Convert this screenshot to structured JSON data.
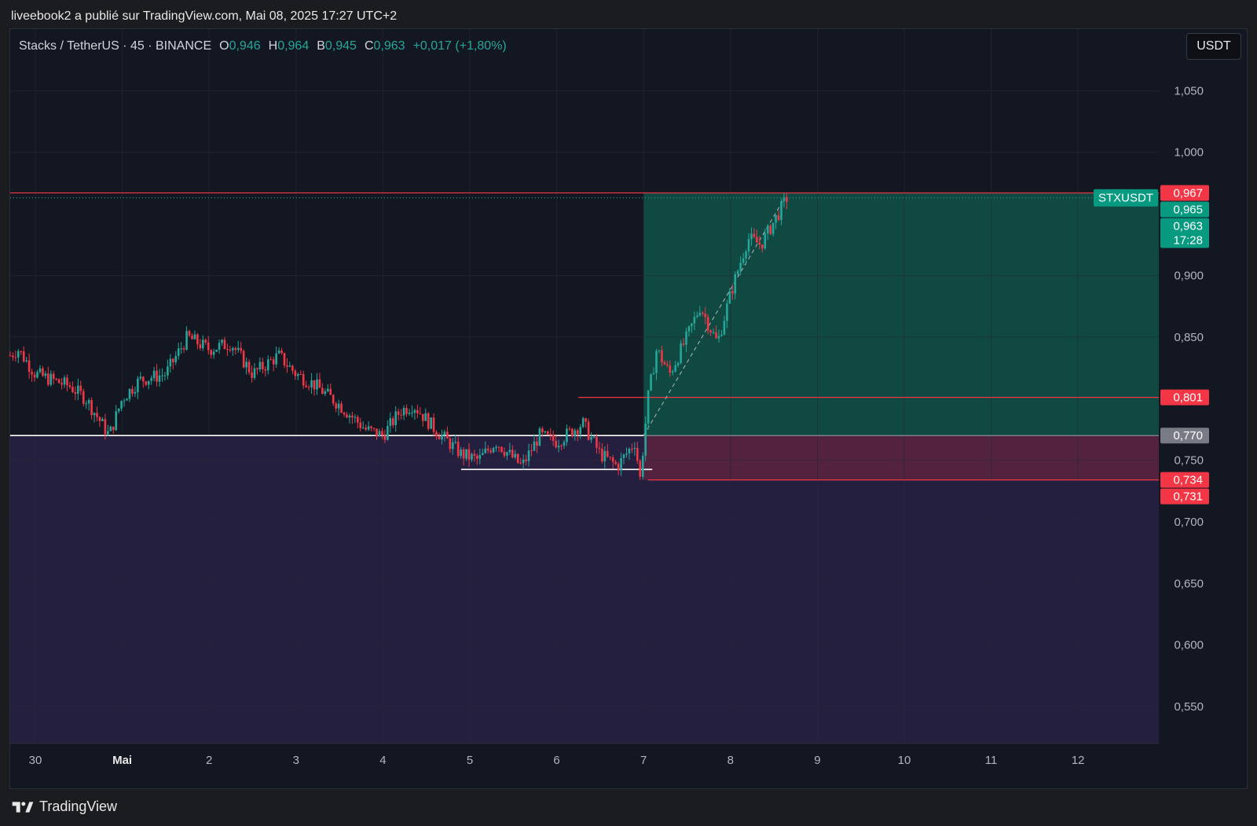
{
  "header": {
    "published": "liveebook2 a publié sur TradingView.com, Mai 08, 2025 17:27 UTC+2"
  },
  "legend": {
    "symbol": "Stacks / TetherUS · 45 · BINANCE",
    "o_label": "O",
    "o_value": "0,946",
    "h_label": "H",
    "h_value": "0,964",
    "b_label": "B",
    "b_value": "0,945",
    "c_label": "C",
    "c_value": "0,963",
    "change": "+0,017 (+1,80%)"
  },
  "currency_button": "USDT",
  "footer": {
    "brand": "TradingView"
  },
  "colors": {
    "up": "#26a69a",
    "down": "#f23645",
    "background": "#131722",
    "grid": "#252a36",
    "profit_zone": "#0f5247",
    "stop_zone": "#5a2340",
    "below_zone": "#241e3f",
    "axis_text": "#b2b5be",
    "support_line": "#ffffff"
  },
  "chart_data": {
    "type": "candlestick",
    "symbol": "STXUSDT",
    "ylim": [
      0.52,
      1.1
    ],
    "y_ticks": [
      {
        "value": 1.05,
        "label": "1,050"
      },
      {
        "value": 1.0,
        "label": "1,000"
      },
      {
        "value": 0.9,
        "label": "0,900"
      },
      {
        "value": 0.85,
        "label": "0,850"
      },
      {
        "value": 0.75,
        "label": "0,750"
      },
      {
        "value": 0.7,
        "label": "0,700"
      },
      {
        "value": 0.65,
        "label": "0,650"
      },
      {
        "value": 0.6,
        "label": "0,600"
      },
      {
        "value": 0.55,
        "label": "0,550"
      }
    ],
    "x_ticks": [
      {
        "day": 0,
        "label": "30"
      },
      {
        "day": 1,
        "label": "Mai"
      },
      {
        "day": 2,
        "label": "2"
      },
      {
        "day": 3,
        "label": "3"
      },
      {
        "day": 4,
        "label": "4"
      },
      {
        "day": 5,
        "label": "5"
      },
      {
        "day": 6,
        "label": "6"
      },
      {
        "day": 7,
        "label": "7"
      },
      {
        "day": 8,
        "label": "8"
      },
      {
        "day": 9,
        "label": "9"
      },
      {
        "day": 10,
        "label": "10"
      },
      {
        "day": 11,
        "label": "11"
      },
      {
        "day": 12,
        "label": "12"
      }
    ],
    "price_path": [
      [
        -0.29,
        0.835
      ],
      [
        -0.2,
        0.84
      ],
      [
        0,
        0.82
      ],
      [
        0.4,
        0.81
      ],
      [
        0.58,
        0.8
      ],
      [
        0.85,
        0.77
      ],
      [
        1.0,
        0.8
      ],
      [
        1.2,
        0.815
      ],
      [
        1.5,
        0.82
      ],
      [
        1.75,
        0.85
      ],
      [
        2.0,
        0.84
      ],
      [
        2.25,
        0.845
      ],
      [
        2.5,
        0.82
      ],
      [
        2.8,
        0.835
      ],
      [
        3.0,
        0.82
      ],
      [
        3.2,
        0.812
      ],
      [
        3.5,
        0.795
      ],
      [
        3.8,
        0.775
      ],
      [
        4.0,
        0.77
      ],
      [
        4.2,
        0.79
      ],
      [
        4.35,
        0.795
      ],
      [
        4.6,
        0.775
      ],
      [
        4.9,
        0.755
      ],
      [
        5.1,
        0.75
      ],
      [
        5.3,
        0.765
      ],
      [
        5.6,
        0.745
      ],
      [
        5.8,
        0.77
      ],
      [
        6.0,
        0.765
      ],
      [
        6.3,
        0.78
      ],
      [
        6.5,
        0.755
      ],
      [
        6.7,
        0.745
      ],
      [
        6.9,
        0.765
      ],
      [
        6.96,
        0.735
      ],
      [
        7.05,
        0.8
      ],
      [
        7.15,
        0.84
      ],
      [
        7.3,
        0.82
      ],
      [
        7.5,
        0.85
      ],
      [
        7.65,
        0.875
      ],
      [
        7.85,
        0.845
      ],
      [
        8.0,
        0.885
      ],
      [
        8.2,
        0.93
      ],
      [
        8.35,
        0.925
      ],
      [
        8.55,
        0.95
      ],
      [
        8.65,
        0.963
      ]
    ],
    "support_lines": [
      {
        "price": 0.77,
        "from": -0.29,
        "to": 7.0
      },
      {
        "price": 0.7425,
        "from": 4.9,
        "to": 7.1
      }
    ],
    "position": {
      "type": "long",
      "start_day": 7.0,
      "entry": 0.77,
      "target": 0.967,
      "stop": 0.734,
      "trend_line": [
        [
          7.0,
          0.77
        ],
        [
          8.6,
          0.96
        ]
      ]
    },
    "price_lines": [
      {
        "price": 0.967,
        "from_day": -0.29,
        "style": "solid",
        "color": "#f23645"
      },
      {
        "price": 0.963,
        "from_day": -0.29,
        "style": "dotted",
        "color": "#26a69a"
      },
      {
        "price": 0.801,
        "from_day": 6.25,
        "style": "solid",
        "color": "#f23645"
      },
      {
        "price": 0.77,
        "from_day": 7.0,
        "style": "solid",
        "color": "#9598a1"
      },
      {
        "price": 0.734,
        "from_day": 7.05,
        "style": "solid",
        "color": "#f23645"
      }
    ],
    "price_labels": [
      {
        "price": 0.967,
        "text": "0,967",
        "bg": "#f23645"
      },
      {
        "price": 0.965,
        "text": "0,965",
        "bg": "#089981"
      },
      {
        "price": 0.963,
        "text": "0,963",
        "text2": "17:28",
        "bg": "#089981"
      },
      {
        "price": 0.801,
        "text": "0,801",
        "bg": "#f23645"
      },
      {
        "price": 0.77,
        "text": "0,770",
        "bg": "#787b86"
      },
      {
        "price": 0.734,
        "text": "0,734",
        "bg": "#f23645"
      },
      {
        "price": 0.731,
        "text": "0,731",
        "bg": "#f23645"
      }
    ],
    "symbol_tag": {
      "text": "STXUSDT",
      "price": 0.963
    }
  }
}
